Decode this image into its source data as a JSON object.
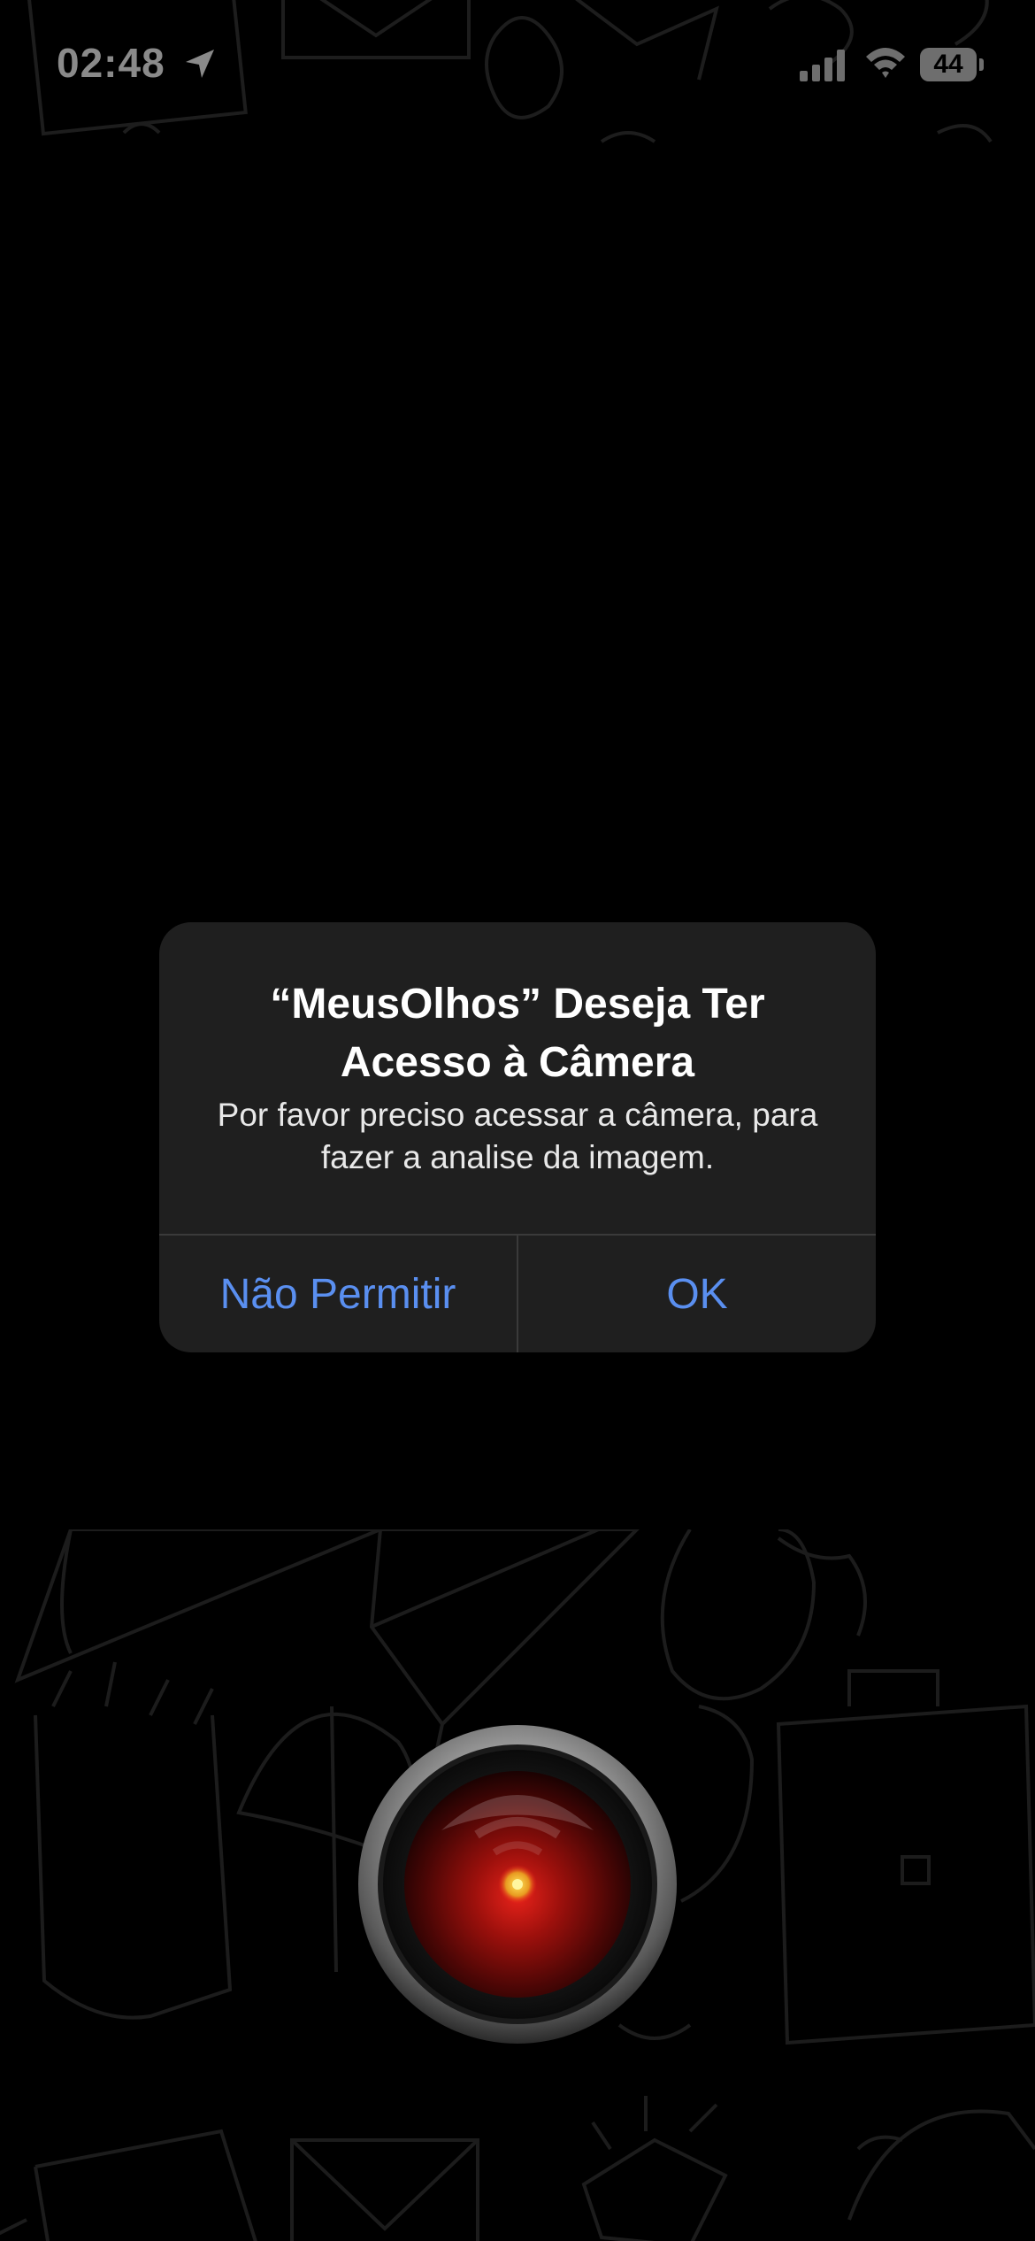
{
  "status_bar": {
    "time": "02:48",
    "battery_level": "44",
    "location_icon": "location-arrow-icon",
    "signal_icon": "cellular-signal-icon",
    "wifi_icon": "wifi-icon"
  },
  "alert": {
    "title": "“MeusOlhos” Deseja Ter Acesso à Câmera",
    "message": "Por favor preciso acessar a câmera, para fazer a analise da imagem.",
    "deny_label": "Não Permitir",
    "ok_label": "OK"
  },
  "camera_button": {
    "icon": "red-eye-lens-icon"
  },
  "colors": {
    "background": "#000000",
    "alert_background": "#1f1f1f",
    "alert_button_text": "#5a8ff0",
    "lens_red": "#c0150f"
  }
}
